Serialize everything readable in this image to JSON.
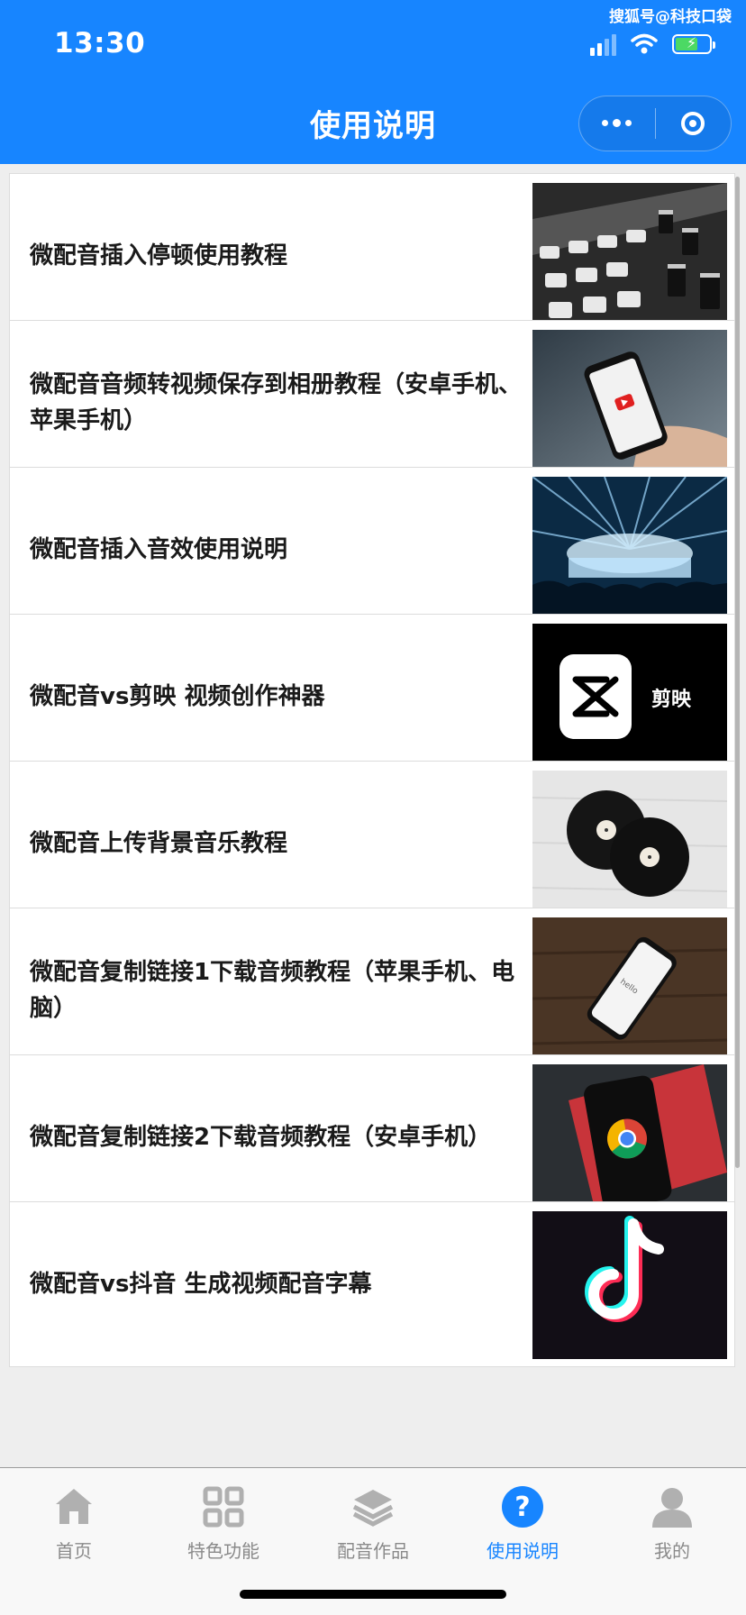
{
  "status_bar": {
    "time": "13:30",
    "watermark": "搜狐号@科技口袋",
    "signal_icon": "signal-icon",
    "wifi_icon": "wifi-icon",
    "battery_icon": "battery-charging-icon",
    "battery_level": 0.6
  },
  "header": {
    "title": "使用说明",
    "more_icon": "more-dots-icon",
    "close_icon": "target-close-icon",
    "background": "#1785ff"
  },
  "articles": [
    {
      "title": "微配音插入停顿使用教程",
      "thumb": "mixing-console-image"
    },
    {
      "title": "微配音音频转视频保存到相册教程（安卓手机、苹果手机）",
      "thumb": "phone-youtube-image"
    },
    {
      "title": "微配音插入音效使用说明",
      "thumb": "concert-stage-image"
    },
    {
      "title": "微配音vs剪映 视频创作神器",
      "thumb": "capcut-logo-image",
      "thumb_text": "剪映"
    },
    {
      "title": "微配音上传背景音乐教程",
      "thumb": "vinyl-records-image"
    },
    {
      "title": "微配音复制链接1下载音频教程（苹果手机、电脑）",
      "thumb": "iphone-on-wood-image",
      "thumb_text": "hello"
    },
    {
      "title": "微配音复制链接2下载音频教程（安卓手机）",
      "thumb": "phone-chrome-image"
    },
    {
      "title": "微配音vs抖音 生成视频配音字幕",
      "thumb": "tiktok-logo-image"
    }
  ],
  "tabbar": {
    "active_color": "#1785ff",
    "inactive_color": "#8a8a8a",
    "tabs": [
      {
        "label": "首页",
        "icon": "home-icon",
        "active": false
      },
      {
        "label": "特色功能",
        "icon": "grid-icon",
        "active": false
      },
      {
        "label": "配音作品",
        "icon": "layers-icon",
        "active": false
      },
      {
        "label": "使用说明",
        "icon": "help-icon",
        "active": true
      },
      {
        "label": "我的",
        "icon": "user-icon",
        "active": false
      }
    ]
  }
}
